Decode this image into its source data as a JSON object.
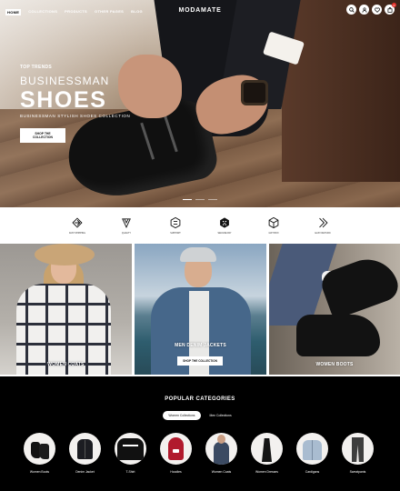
{
  "nav": {
    "links": [
      "HOME",
      "COLLECTIONS",
      "PRODUCTS",
      "OTHER PAGES",
      "BLOG"
    ],
    "logo": "MODAMATE",
    "icons": [
      "search-icon",
      "user-icon",
      "wishlist-icon",
      "cart-icon"
    ],
    "cart_count": "0"
  },
  "hero": {
    "eyebrow": "TOP TRENDS",
    "subtitle": "BUSINESSMAN",
    "title": "SHOES",
    "description": "BUSINESSMAN STYLISH SHOES COLLECTION",
    "button": "SHOP THE COLLECTION",
    "slide_count": 3,
    "active_slide": 1
  },
  "features": [
    {
      "icon": "fast-shipping-icon",
      "label": "FAST SHIPPING"
    },
    {
      "icon": "quality-icon",
      "label": "QUALITY"
    },
    {
      "icon": "support-icon",
      "label": "SUPPORT"
    },
    {
      "icon": "secure-pay-icon",
      "label": "SECURE PAY"
    },
    {
      "icon": "gift-box-icon",
      "label": "GIFT BOX"
    },
    {
      "icon": "easy-return-icon",
      "label": "EASY RETURN"
    }
  ],
  "tiles": [
    {
      "label": "WOMEN COATS"
    },
    {
      "label": "MEN DENIM JACKETS",
      "button": "SHOP THE COLLECTION"
    },
    {
      "label": "WOMEN BOOTS"
    }
  ],
  "popular": {
    "title": "POPULAR CATEGORIES",
    "tabs": [
      {
        "label": "Women Collections",
        "active": true
      },
      {
        "label": "Men Collections",
        "active": false
      }
    ],
    "categories": [
      {
        "label": "Women Boots"
      },
      {
        "label": "Denim Jacket"
      },
      {
        "label": "T-Shirt"
      },
      {
        "label": "Hoodies"
      },
      {
        "label": "Women Coats"
      },
      {
        "label": "Women Dresses"
      },
      {
        "label": "Cardigans"
      },
      {
        "label": "Sweatpants"
      }
    ]
  },
  "colors": {
    "accent": "#e4322b",
    "dark": "#000000"
  }
}
